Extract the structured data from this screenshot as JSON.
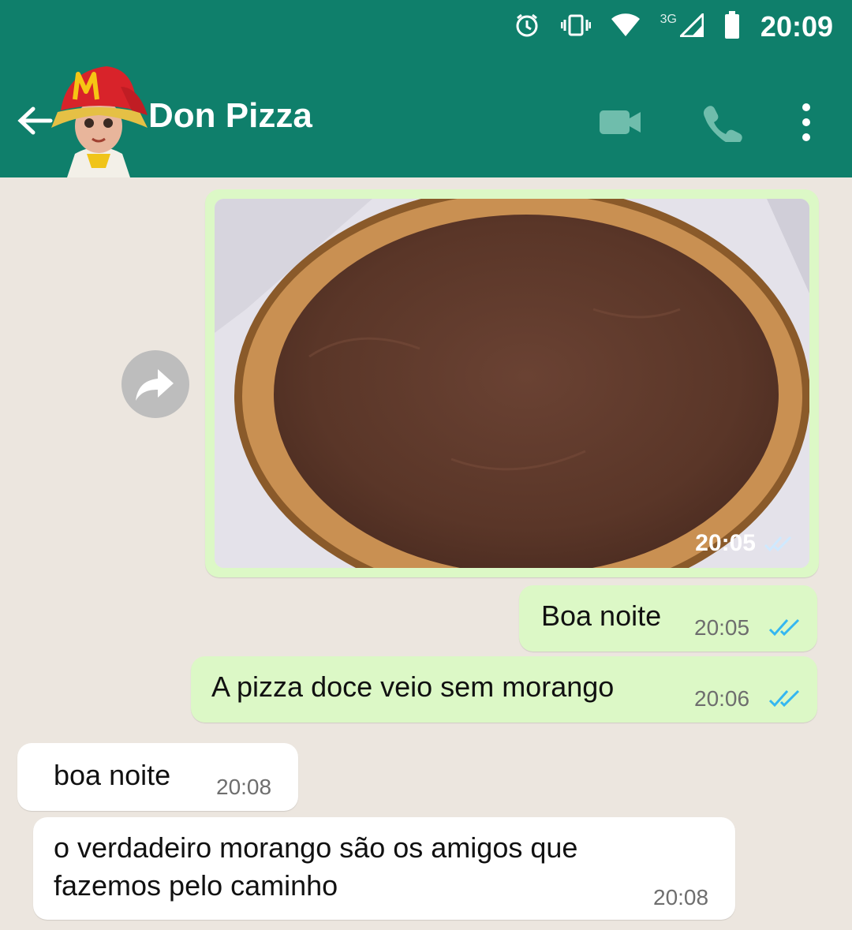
{
  "status_bar": {
    "network": "3G",
    "time": "20:09"
  },
  "header": {
    "contact_name": "Don Pizza"
  },
  "messages": [
    {
      "direction": "out",
      "type": "image",
      "time": "20:05",
      "status": "read"
    },
    {
      "direction": "out",
      "type": "text",
      "text": "Boa noite",
      "time": "20:05",
      "status": "read"
    },
    {
      "direction": "out",
      "type": "text",
      "text": "A pizza doce veio sem morango",
      "time": "20:06",
      "status": "read"
    },
    {
      "direction": "in",
      "type": "text",
      "text": "boa noite",
      "time": "20:08"
    },
    {
      "direction": "in",
      "type": "text",
      "text_line1": "o verdadeiro morango são os amigos que",
      "text_line2": "fazemos pelo caminho",
      "time": "20:08"
    }
  ],
  "colors": {
    "header": "#0f7f6b",
    "outgoing_bubble": "#dcf8c6",
    "incoming_bubble": "#ffffff",
    "read_ticks": "#34b7f1"
  },
  "icons": [
    "alarm-icon",
    "vibrate-icon",
    "wifi-icon",
    "signal-icon",
    "battery-icon",
    "back-arrow-icon",
    "video-call-icon",
    "phone-icon",
    "more-vert-icon",
    "forward-icon",
    "double-check-icon"
  ]
}
